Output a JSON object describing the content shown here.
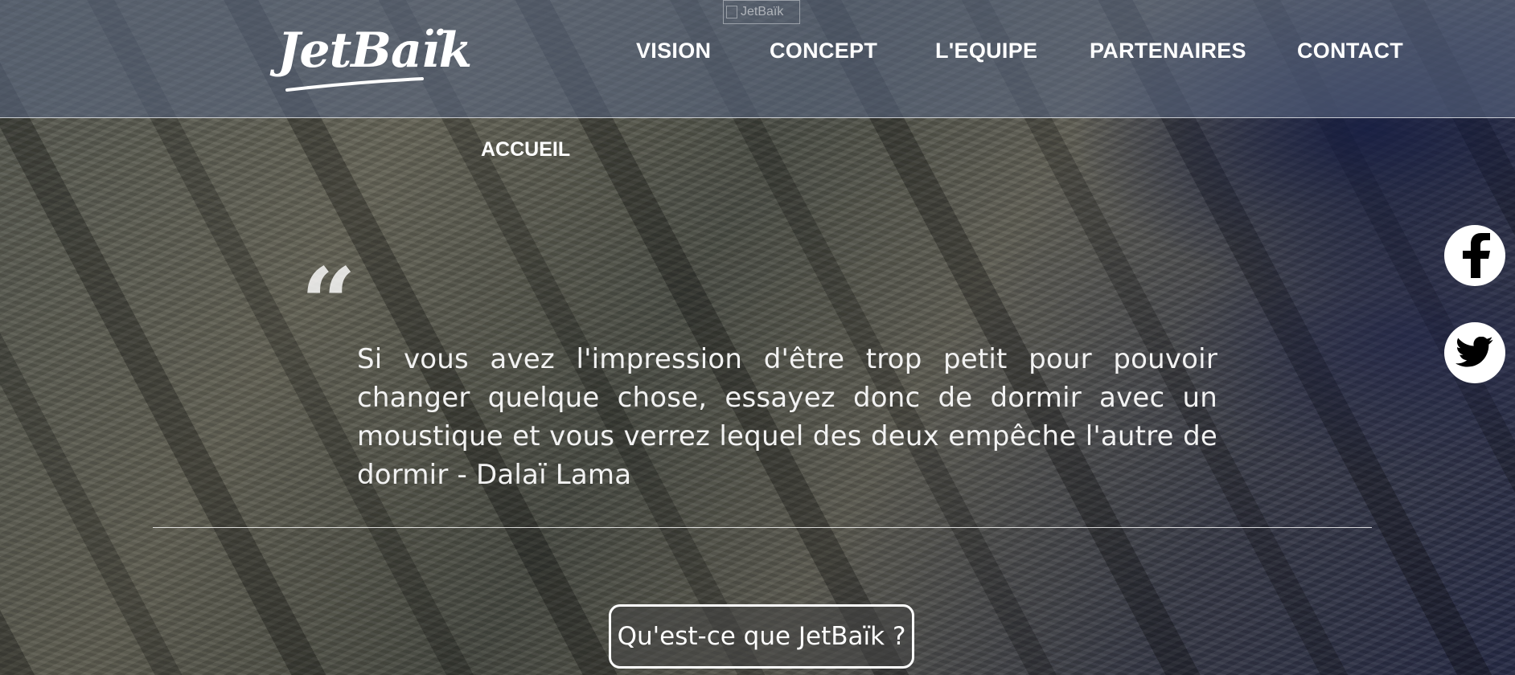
{
  "brand": {
    "logo_text": "JetBaïk",
    "logo_alt": "JetBaïk"
  },
  "nav": {
    "items": [
      {
        "label": "VISION"
      },
      {
        "label": "CONCEPT"
      },
      {
        "label": "L'EQUIPE"
      },
      {
        "label": "PARTENAIRES"
      },
      {
        "label": "CONTACT"
      }
    ],
    "sub_item": "ACCUEIL"
  },
  "hero": {
    "quote_mark": "“",
    "quote": "Si vous avez l'impression d'être trop petit pour pouvoir changer quelque chose, essayez donc de dormir avec un moustique et vous verrez lequel des deux empêche l'autre de dormir - Dalaï Lama",
    "cta_label": "Qu'est-ce que JetBaïk ?"
  },
  "social": [
    {
      "icon": "facebook-icon"
    },
    {
      "icon": "twitter-icon"
    }
  ],
  "colors": {
    "header_overlay": "#586680",
    "text": "#ffffff",
    "social_bg": "#ffffff",
    "social_glyph": "#000000"
  }
}
